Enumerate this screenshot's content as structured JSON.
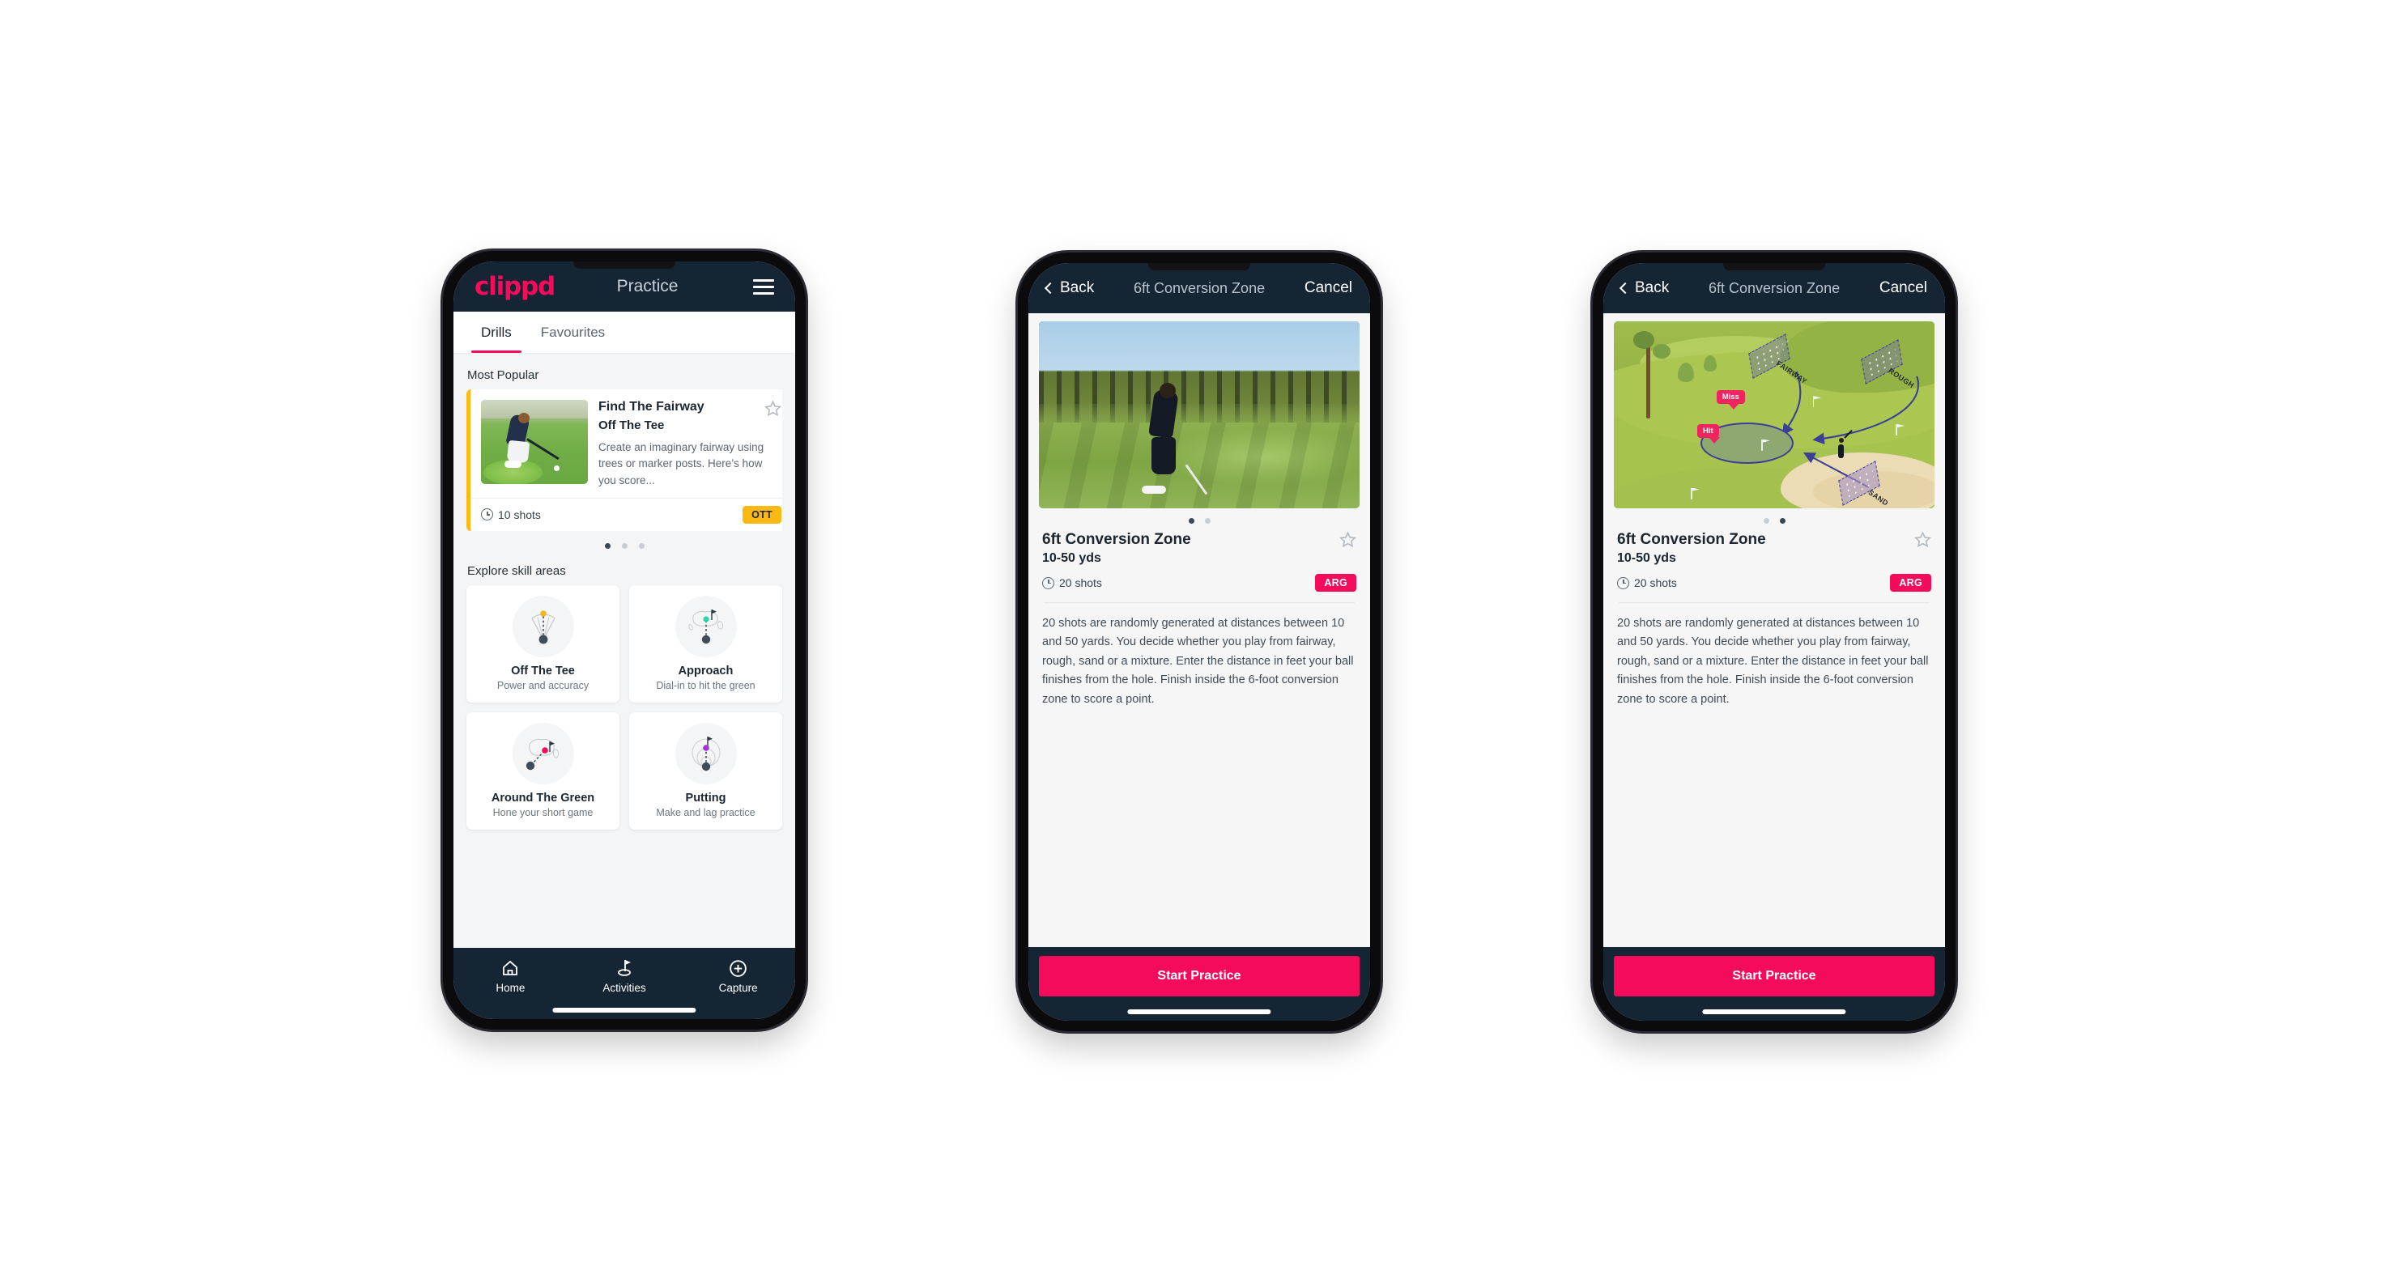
{
  "phone1": {
    "appbar": {
      "logo": "clippd",
      "title": "Practice",
      "menu_icon": "hamburger-icon"
    },
    "tabs": [
      {
        "label": "Drills",
        "active": true
      },
      {
        "label": "Favourites",
        "active": false
      }
    ],
    "most_popular": {
      "section_title": "Most Popular",
      "card": {
        "name": "Find The Fairway",
        "category": "Off The Tee",
        "description": "Create an imaginary fairway using trees or marker posts. Here’s how you score...",
        "shots": "10 shots",
        "badge": "OTT",
        "badge_color": "#fcb913",
        "accent_color": "#fcb913",
        "favourite_icon": "star-outline-icon"
      },
      "peek_accent_color": "#3fd9b6",
      "dots": [
        true,
        false,
        false
      ]
    },
    "explore": {
      "section_title": "Explore skill areas",
      "cards": [
        {
          "name": "Off The Tee",
          "desc": "Power and accuracy",
          "icon": "tee-fan-icon",
          "dot_color": "#f5b324"
        },
        {
          "name": "Approach",
          "desc": "Dial-in to hit the green",
          "icon": "approach-green-icon",
          "dot_color": "#2dd4a7"
        },
        {
          "name": "Around The Green",
          "desc": "Hone your short game",
          "icon": "around-green-icon",
          "dot_color": "#f50b5c"
        },
        {
          "name": "Putting",
          "desc": "Make and lag practice",
          "icon": "putting-rings-icon",
          "dot_color": "#a633d6"
        }
      ]
    },
    "bottomnav": [
      {
        "label": "Home",
        "icon": "home-icon",
        "active": false
      },
      {
        "label": "Activities",
        "icon": "golf-flag-icon",
        "active": true
      },
      {
        "label": "Capture",
        "icon": "plus-circle-icon",
        "active": false
      }
    ]
  },
  "phone2": {
    "navbar": {
      "back": "Back",
      "title": "6ft Conversion Zone",
      "cancel": "Cancel",
      "back_icon": "chevron-left-icon"
    },
    "media_kind": "photo",
    "dots": [
      true,
      false
    ],
    "detail": {
      "name": "6ft Conversion Zone",
      "distance": "10-50 yds",
      "shots": "20 shots",
      "badge": "ARG",
      "badge_color": "#f50b5c",
      "favourite_icon": "star-outline-icon",
      "description": "20 shots are randomly generated at distances between 10 and 50 yards. You decide whether you play from fairway, rough, sand or a mixture. Enter the distance in feet your ball finishes from the hole. Finish inside the 6-foot conversion zone to score a point."
    },
    "cta": "Start Practice"
  },
  "phone3": {
    "navbar": {
      "back": "Back",
      "title": "6ft Conversion Zone",
      "cancel": "Cancel",
      "back_icon": "chevron-left-icon"
    },
    "media_kind": "illustration",
    "illustration": {
      "zone_labels": [
        "FAIRWAY",
        "ROUGH",
        "SAND"
      ],
      "markers": [
        {
          "label": "Miss",
          "color": "#f0245f"
        },
        {
          "label": "Hit",
          "color": "#f0245f"
        }
      ]
    },
    "dots": [
      false,
      true
    ],
    "detail": {
      "name": "6ft Conversion Zone",
      "distance": "10-50 yds",
      "shots": "20 shots",
      "badge": "ARG",
      "badge_color": "#f50b5c",
      "favourite_icon": "star-outline-icon",
      "description": "20 shots are randomly generated at distances between 10 and 50 yards. You decide whether you play from fairway, rough, sand or a mixture. Enter the distance in feet your ball finishes from the hole. Finish inside the 6-foot conversion zone to score a point."
    },
    "cta": "Start Practice"
  }
}
